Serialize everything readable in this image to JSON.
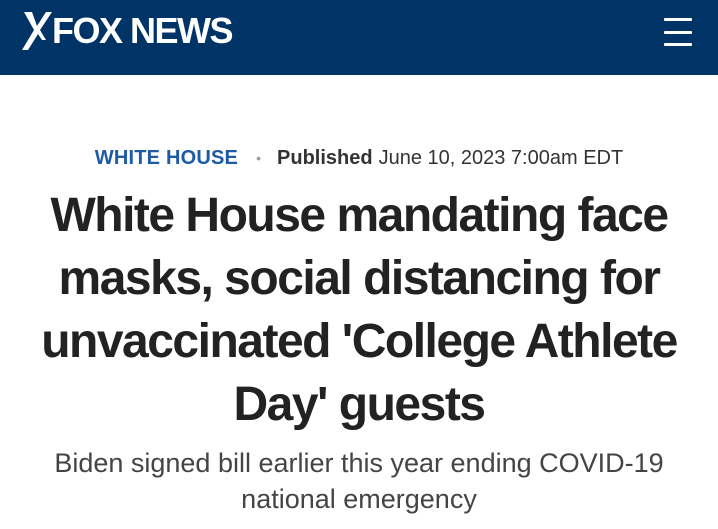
{
  "header": {
    "logo_text": "FOX NEWS",
    "brand_color": "#003366",
    "menu_icon": "hamburger-menu-icon"
  },
  "article": {
    "category": "WHITE HOUSE",
    "separator": "•",
    "published_label": "Published",
    "published_date": "June 10, 2023 7:00am EDT",
    "headline": "White House mandating face masks, social distancing for unvaccinated 'College Athlete Day' guests",
    "subheadline": "Biden signed bill earlier this year ending COVID-19 national emergency",
    "category_color": "#1e5aa6"
  }
}
